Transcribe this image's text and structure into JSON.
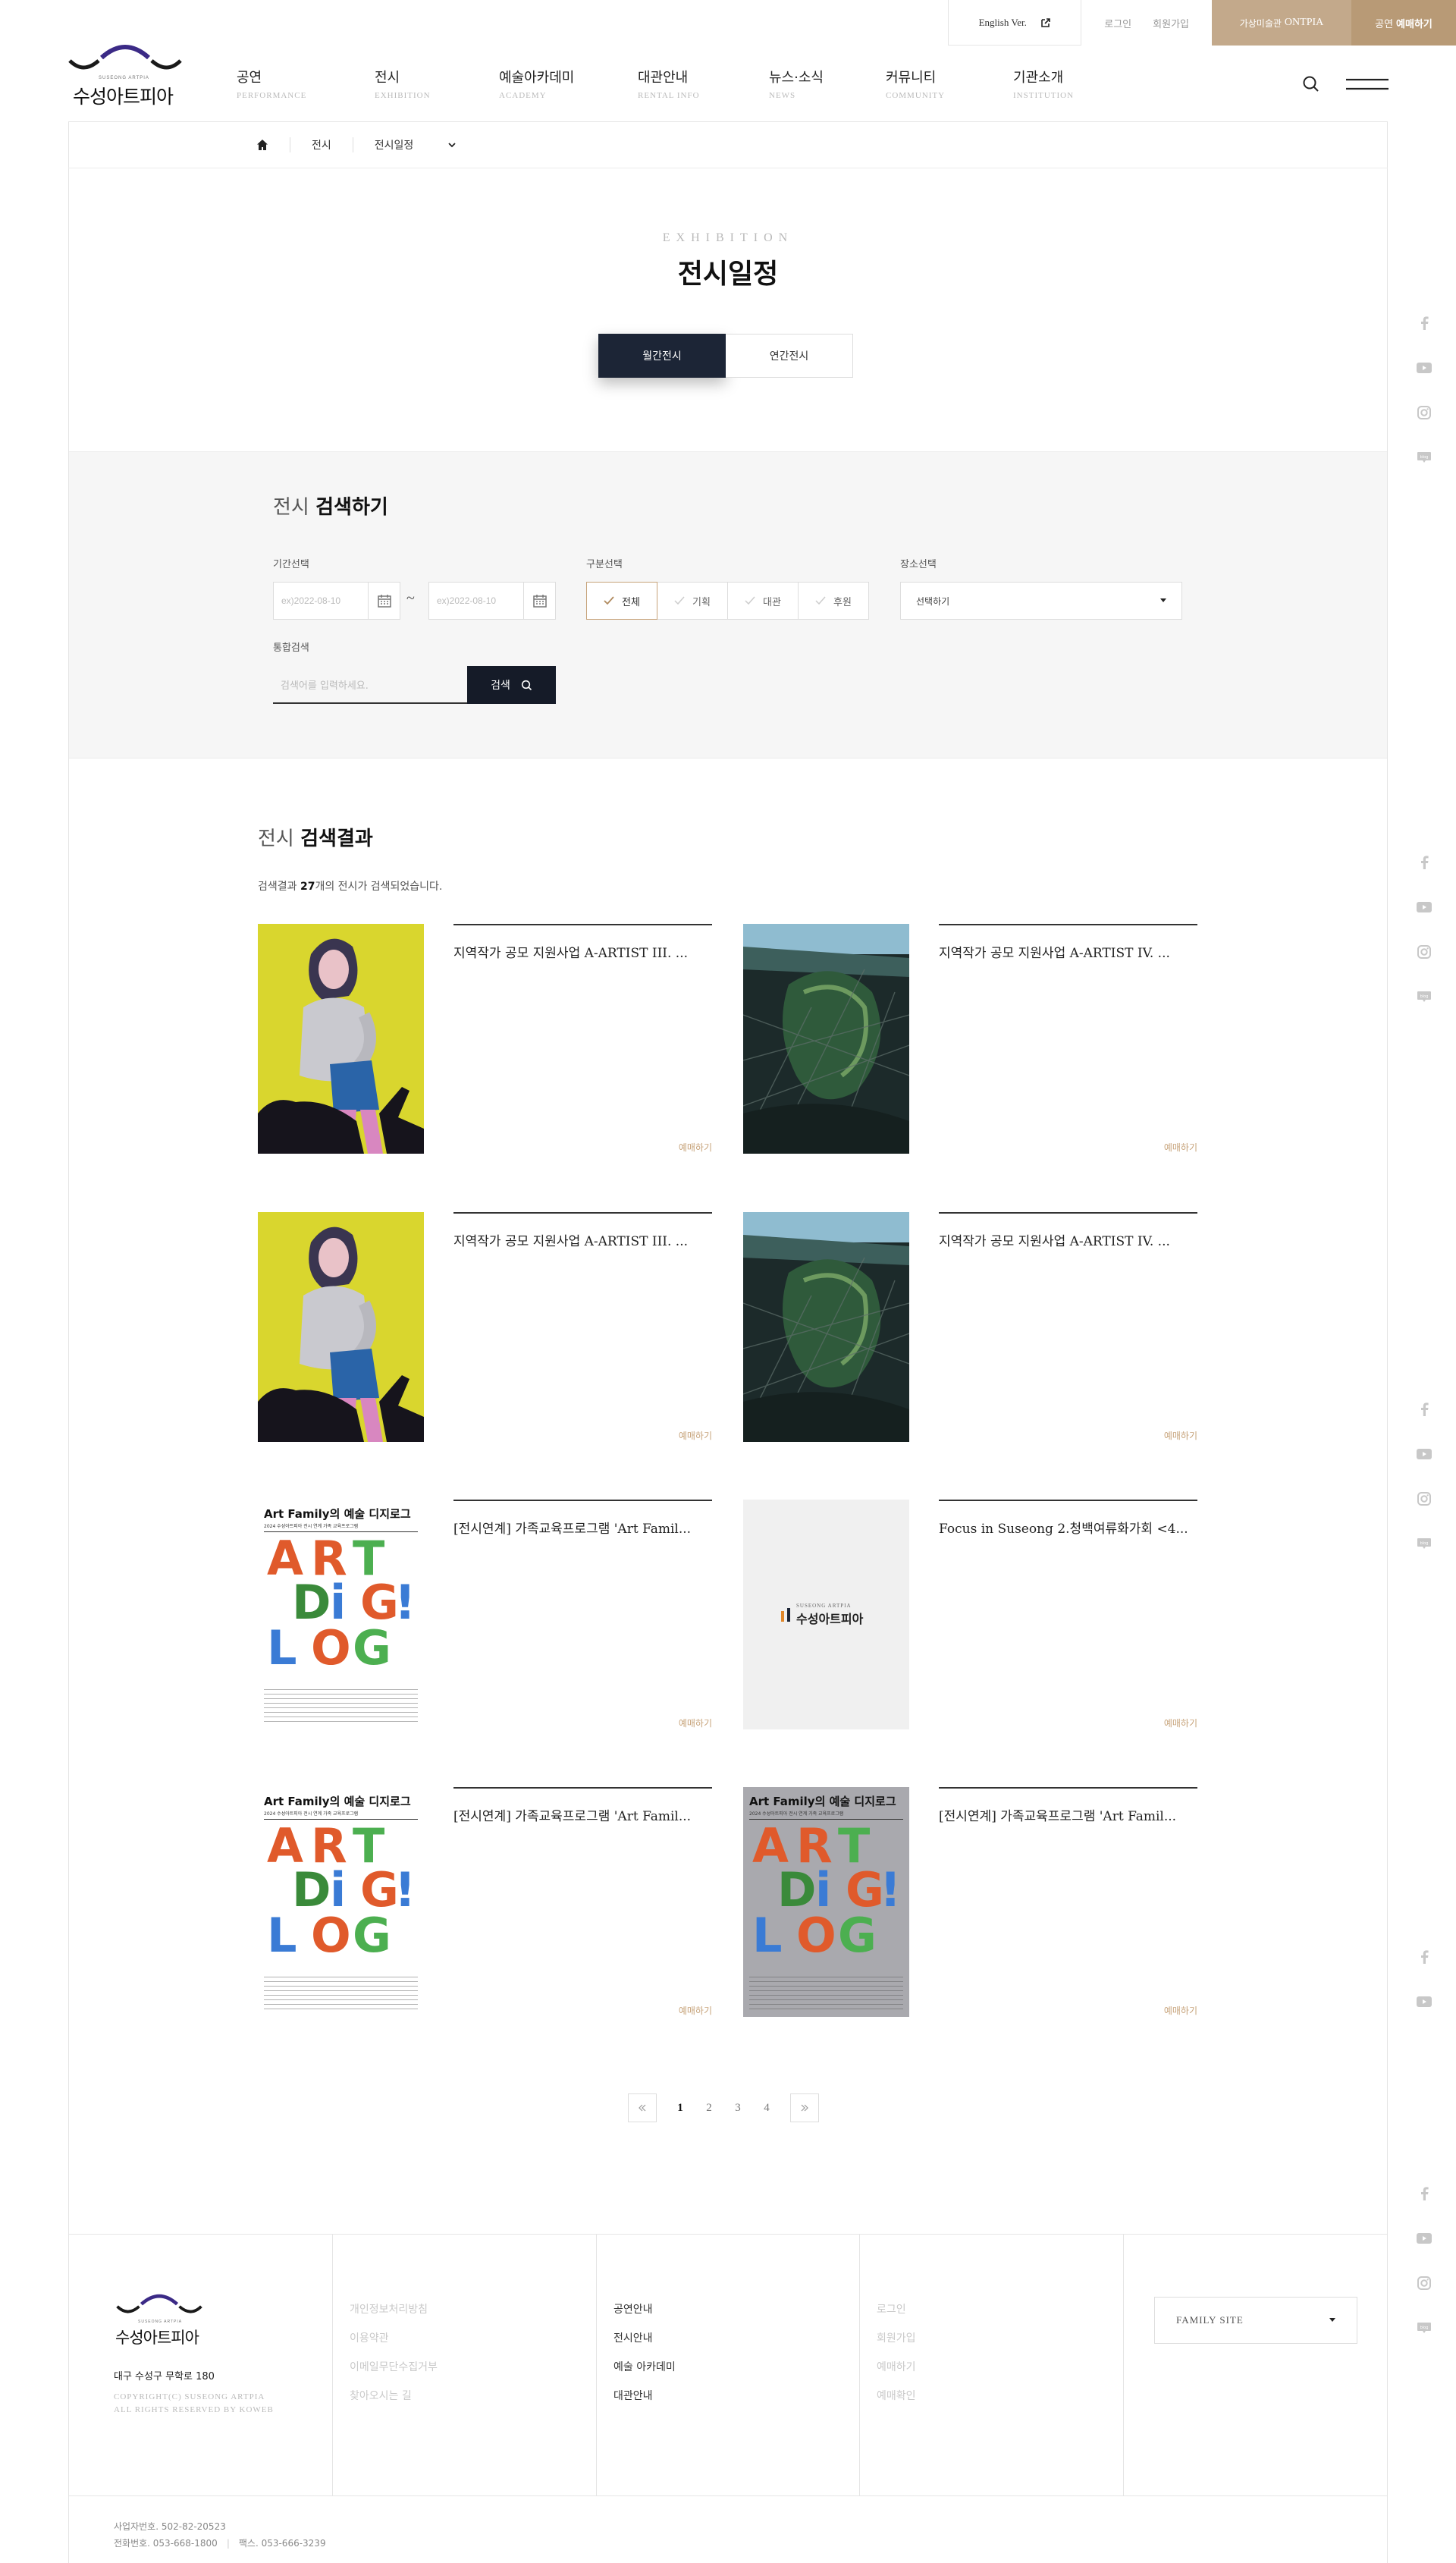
{
  "topbar": {
    "english": "English Ver.",
    "login": "로그인",
    "join": "회원가입",
    "ontpia_prefix": "가상미술관",
    "ontpia_name": "ONTPIA",
    "reserve_prefix": "공연",
    "reserve_label": "예매하기"
  },
  "logo": {
    "small": "SUSEONG ARTPIA",
    "name": "수성아트피아"
  },
  "gnb": [
    {
      "ko": "공연",
      "en": "PERFORMANCE"
    },
    {
      "ko": "전시",
      "en": "EXHIBITION"
    },
    {
      "ko": "예술아카데미",
      "en": "ACADEMY"
    },
    {
      "ko": "대관안내",
      "en": "RENTAL INFO"
    },
    {
      "ko": "뉴스·소식",
      "en": "NEWS"
    },
    {
      "ko": "커뮤니티",
      "en": "COMMUNITY"
    },
    {
      "ko": "기관소개",
      "en": "INSTITUTION"
    }
  ],
  "breadcrumb": {
    "level1": "전시",
    "level2": "전시일정"
  },
  "page": {
    "subtitle_en": "EXHIBITION",
    "title": "전시일정"
  },
  "tabs": [
    "월간전시",
    "연간전시"
  ],
  "search": {
    "heading_light": "전시",
    "heading_bold": "검색하기",
    "period_label": "기간선택",
    "date_from": "ex)2022-08-10",
    "date_to": "ex)2022-08-10",
    "tilde": "~",
    "type_label": "구분선택",
    "types": [
      "전체",
      "기획",
      "대관",
      "후원"
    ],
    "place_label": "장소선택",
    "place_value": "선택하기",
    "keyword_label": "통합검색",
    "keyword_placeholder": "검색어를 입력하세요.",
    "button": "검색"
  },
  "results": {
    "heading_light": "전시",
    "heading_bold": "검색결과",
    "count_prefix": "검색결과 ",
    "count": "27",
    "count_suffix": "개의 전시가 검색되었습니다.",
    "reserve": "예매하기",
    "items": [
      {
        "title": "지역작가 공모 지원사업 A-ARTIST III. ...",
        "thumb": "yellow-portrait"
      },
      {
        "title": "지역작가 공모 지원사업 A-ARTIST IV. ...",
        "thumb": "dark-sculpture"
      },
      {
        "title": "지역작가 공모 지원사업 A-ARTIST III. ...",
        "thumb": "yellow-portrait"
      },
      {
        "title": "지역작가 공모 지원사업 A-ARTIST IV. ...",
        "thumb": "dark-sculpture"
      },
      {
        "title": "[전시연계] 가족교육프로그램 'Art Famil...",
        "thumb": "art-digilog"
      },
      {
        "title": "Focus in Suseong 2.청백여류화가회 <4...",
        "thumb": "logo-placeholder"
      },
      {
        "title": "[전시연계] 가족교육프로그램 'Art Famil...",
        "thumb": "art-digilog"
      },
      {
        "title": "[전시연계] 가족교육프로그램 'Art Famil...",
        "thumb": "art-digilog-gray"
      }
    ]
  },
  "poster": {
    "title": "Art Family의 예술 디지로그",
    "sub": "2024 수성아트피아 전시 연계 가족 교육프로그램",
    "letters": [
      "A",
      "R",
      "T",
      "D",
      "i",
      "G",
      "!",
      "L",
      "O",
      "G"
    ]
  },
  "placeholder_logo": {
    "small": "SUSEONG ARTPIA",
    "name": "수성아트피아"
  },
  "pagination": [
    "1",
    "2",
    "3",
    "4"
  ],
  "social_icons": [
    "facebook-icon",
    "youtube-icon",
    "instagram-icon",
    "blog-icon"
  ],
  "footer": {
    "address": "대구 수성구 무학로 180",
    "copyright1": "COPYRIGHT(C) SUSEONG ARTPIA",
    "copyright2": "ALL RIGHTS RESERVED BY KOWEB",
    "col1": [
      "개인정보처리방침",
      "이용약관",
      "이메일무단수집거부",
      "찾아오시는 길"
    ],
    "col2": [
      "공연안내",
      "전시안내",
      "예술 아카데미",
      "대관안내"
    ],
    "col3": [
      "로그인",
      "회원가입",
      "예매하기",
      "예매확인"
    ],
    "family": "FAMILY SITE",
    "biz_no": "사업자번호. 502-82-20523",
    "tel": "전화번호. 053-668-1800",
    "fax": "팩스. 053-666-3239"
  },
  "colors": {
    "navy": "#1c2536",
    "gold": "#c7a37a",
    "ontpia": "#c3a98b",
    "reserve": "#b89a76"
  }
}
